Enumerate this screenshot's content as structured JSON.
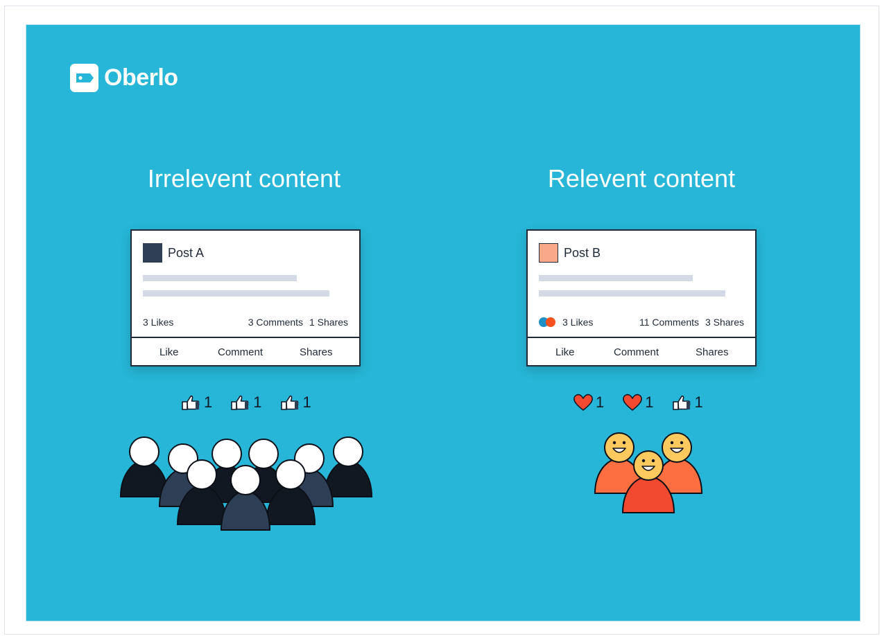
{
  "brand": {
    "name": "Oberlo"
  },
  "colors": {
    "background": "#27b6d7",
    "post_a_square": "#2e3e55",
    "post_b_square": "#f9a98a",
    "heart": "#f14a31",
    "dot_blue": "#1f8fc8",
    "dot_red": "#f4511e"
  },
  "left": {
    "heading": "Irrelevent content",
    "post": {
      "title": "Post A",
      "likes": "3 Likes",
      "comments": "3 Comments",
      "shares": "1 Shares"
    },
    "actions": [
      "Like",
      "Comment",
      "Shares"
    ],
    "reactions": [
      {
        "icon": "thumbs-up-icon",
        "count": "1"
      },
      {
        "icon": "thumbs-up-icon",
        "count": "1"
      },
      {
        "icon": "thumbs-up-icon",
        "count": "1"
      }
    ]
  },
  "right": {
    "heading": "Relevent content",
    "post": {
      "title": "Post B",
      "likes": "3 Likes",
      "comments": "11 Comments",
      "shares": "3 Shares"
    },
    "actions": [
      "Like",
      "Comment",
      "Shares"
    ],
    "reactions": [
      {
        "icon": "heart-icon",
        "count": "1"
      },
      {
        "icon": "heart-icon",
        "count": "1"
      },
      {
        "icon": "thumbs-up-icon",
        "count": "1"
      }
    ]
  }
}
